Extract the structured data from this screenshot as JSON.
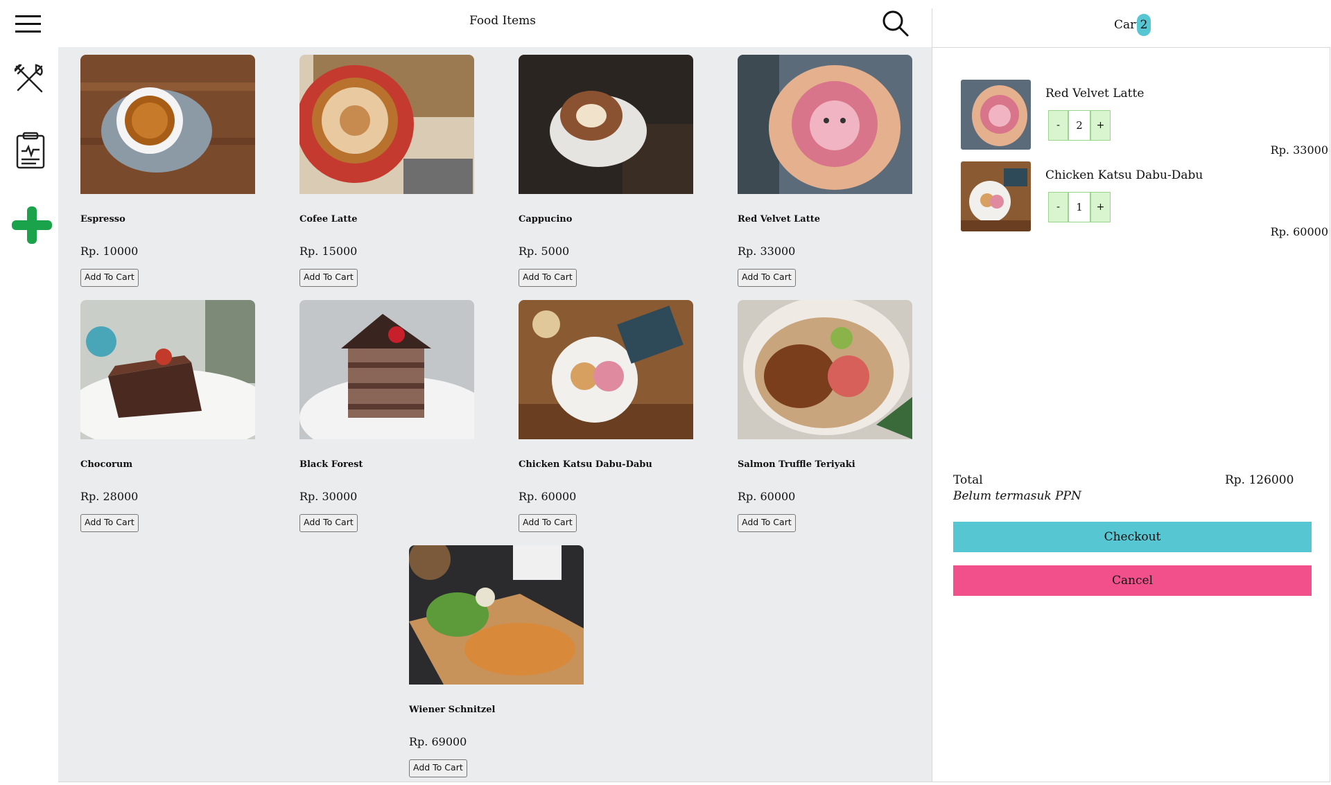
{
  "header": {
    "title": "Food Items"
  },
  "sidebar": {
    "icons": [
      "menu-icon",
      "utensils-icon",
      "clipboard-icon",
      "add-icon"
    ]
  },
  "products": [
    {
      "name": "Espresso",
      "price": "Rp. 10000",
      "add_label": "Add To Cart"
    },
    {
      "name": "Cofee Latte",
      "price": "Rp. 15000",
      "add_label": "Add To Cart"
    },
    {
      "name": "Cappucino",
      "price": "Rp. 5000",
      "add_label": "Add To Cart"
    },
    {
      "name": "Red Velvet Latte",
      "price": "Rp. 33000",
      "add_label": "Add To Cart"
    },
    {
      "name": "Chocorum",
      "price": "Rp. 28000",
      "add_label": "Add To Cart"
    },
    {
      "name": "Black Forest",
      "price": "Rp. 30000",
      "add_label": "Add To Cart"
    },
    {
      "name": "Chicken Katsu Dabu-Dabu",
      "price": "Rp. 60000",
      "add_label": "Add To Cart"
    },
    {
      "name": "Salmon Truffle Teriyaki",
      "price": "Rp. 60000",
      "add_label": "Add To Cart"
    },
    {
      "name": "Wiener Schnitzel",
      "price": "Rp. 69000",
      "add_label": "Add To Cart"
    }
  ],
  "cart": {
    "label": "Cart",
    "count": "2",
    "items": [
      {
        "name": "Red Velvet Latte",
        "minus": "-",
        "qty": "2",
        "plus": "+",
        "price": "Rp. 33000"
      },
      {
        "name": "Chicken Katsu Dabu-Dabu",
        "minus": "-",
        "qty": "1",
        "plus": "+",
        "price": "Rp. 60000"
      }
    ],
    "total_label": "Total",
    "total_value": "Rp. 126000",
    "tax_note": "Belum termasuk PPN",
    "checkout_label": "Checkout",
    "cancel_label": "Cancel"
  },
  "colors": {
    "accent": "#56c6d3",
    "cancel": "#f1508b",
    "add": "#1aa34a",
    "stepper": "#d8f5d0"
  }
}
